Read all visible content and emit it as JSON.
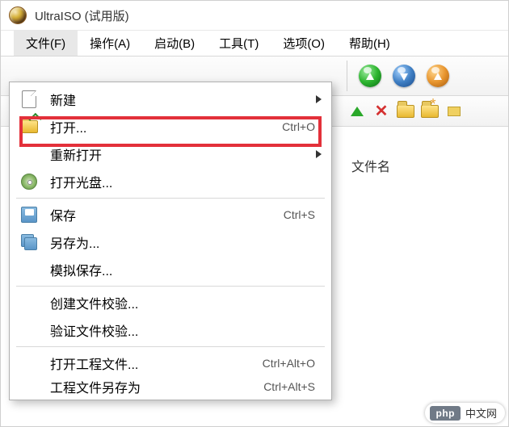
{
  "title": "UltraISO (试用版)",
  "menubar": [
    {
      "label": "文件(F)"
    },
    {
      "label": "操作(A)"
    },
    {
      "label": "启动(B)"
    },
    {
      "label": "工具(T)"
    },
    {
      "label": "选项(O)"
    },
    {
      "label": "帮助(H)"
    }
  ],
  "dropdown": {
    "items": [
      {
        "label": "新建",
        "has_submenu": true,
        "icon": "file"
      },
      {
        "label": "打开...",
        "shortcut": "Ctrl+O",
        "icon": "folder-open",
        "highlight": true
      },
      {
        "label": "重新打开",
        "has_submenu": true
      },
      {
        "label": "打开光盘...",
        "icon": "disc"
      },
      {
        "sep": true
      },
      {
        "label": "保存",
        "shortcut": "Ctrl+S",
        "icon": "save"
      },
      {
        "label": "另存为...",
        "icon": "copy"
      },
      {
        "label": "模拟保存..."
      },
      {
        "sep": true
      },
      {
        "label": "创建文件校验..."
      },
      {
        "label": "验证文件校验..."
      },
      {
        "sep": true
      },
      {
        "label": "打开工程文件...",
        "shortcut": "Ctrl+Alt+O"
      },
      {
        "label": "工程文件另存为",
        "shortcut": "Ctrl+Alt+S"
      }
    ]
  },
  "file_panel": {
    "header": "文件名"
  },
  "watermark": {
    "logo": "php",
    "text": "中文网"
  }
}
